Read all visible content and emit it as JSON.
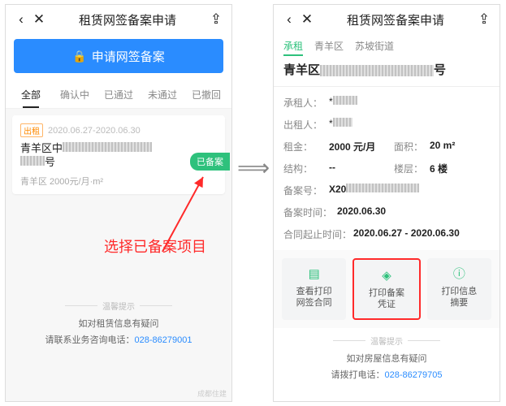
{
  "left": {
    "title": "租赁网签备案申请",
    "primary_btn": "申请网签备案",
    "tabs": [
      "全部",
      "确认中",
      "已通过",
      "未通过",
      "已撤回"
    ],
    "card": {
      "tag": "出租",
      "date": "2020.06.27-2020.06.30",
      "addr_line1": "青羊区中",
      "addr_line2": "号",
      "sub": "青羊区 2000元/月·m²",
      "badge": "已备案"
    },
    "tip_head": "温馨提示",
    "tip_q": "如对租赁信息有疑问",
    "tip_phone_label": "请联系业务咨询电话：",
    "tip_phone": "028-86279001",
    "watermark": "成都住建"
  },
  "annotation": "选择已备案项目",
  "right": {
    "title": "租赁网签备案申请",
    "crumbs": [
      "承租",
      "青羊区",
      "苏坡街道"
    ],
    "big_addr_prefix": "青羊区",
    "big_addr_suffix": "号",
    "rows": {
      "tenant_l": "承租人：",
      "tenant_v": "*",
      "landlord_l": "出租人：",
      "landlord_v": "*",
      "rent_l": "租金：",
      "rent_v": "2000 元/月",
      "area_l": "面积：",
      "area_v": "20 m²",
      "struct_l": "结构：",
      "struct_v": "--",
      "floor_l": "楼层：",
      "floor_v": "6 楼",
      "caseno_l": "备案号：",
      "caseno_v": "X20",
      "casedt_l": "备案时间：",
      "casedt_v": "2020.06.30",
      "term_l": "合同起止时间：",
      "term_v": "2020.06.27 - 2020.06.30"
    },
    "actions": [
      "查看打印\n网签合同",
      "打印备案\n凭证",
      "打印信息\n摘要"
    ],
    "tip_head": "温馨提示",
    "tip_q": "如对房屋信息有疑问",
    "tip_phone_label": "请拨打电话：",
    "tip_phone": "028-86279705"
  }
}
